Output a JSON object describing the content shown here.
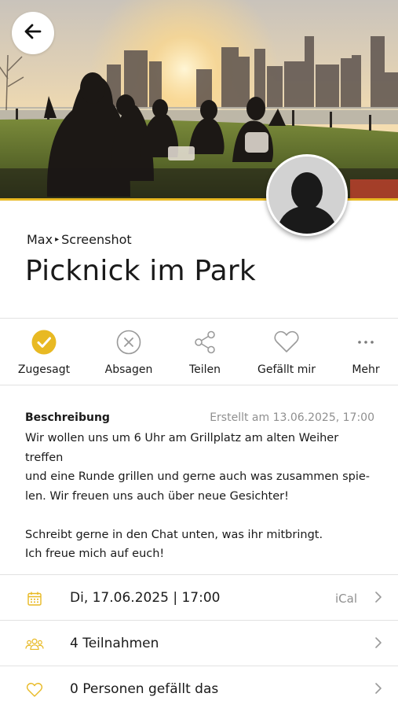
{
  "hero": {
    "image_description_icon": "photo-icon"
  },
  "header": {
    "breadcrumb_owner": "Max",
    "breadcrumb_separator": "▸",
    "breadcrumb_group": "Screenshot",
    "title": "Picknick im Park"
  },
  "actions": [
    {
      "label": "Zugesagt",
      "icon": "check-circle-icon",
      "active": true
    },
    {
      "label": "Absagen",
      "icon": "x-circle-icon"
    },
    {
      "label": "Teilen",
      "icon": "share-icon"
    },
    {
      "label": "Gefällt mir",
      "icon": "heart-icon"
    },
    {
      "label": "Mehr",
      "icon": "more-icon"
    }
  ],
  "description": {
    "heading": "Beschreibung",
    "created": "Erstellt am 13.06.2025, 17:00",
    "line1": "Wir wollen uns um 6 Uhr am Grillplatz am alten Weiher treffen",
    "line2": "und eine Runde grillen und gerne auch was zusammen spie-",
    "line3": "len. Wir freuen uns auch über neue Gesichter!",
    "line4": "Schreibt gerne in den Chat unten, was ihr mitbringt.",
    "line5": "Ich freue mich auf euch!"
  },
  "rows": {
    "date": {
      "text": "Di, 17.06.2025 | 17:00",
      "extra": "iCal"
    },
    "participants": {
      "text": "4 Teilnahmen"
    },
    "likes": {
      "text": "0 Personen gefällt das"
    }
  },
  "colors": {
    "accent": "#e8b923",
    "text": "#1a1a1a",
    "muted": "#8f8f8f",
    "icon_gray": "#9a9a9a",
    "divider": "#e2e2e2"
  }
}
